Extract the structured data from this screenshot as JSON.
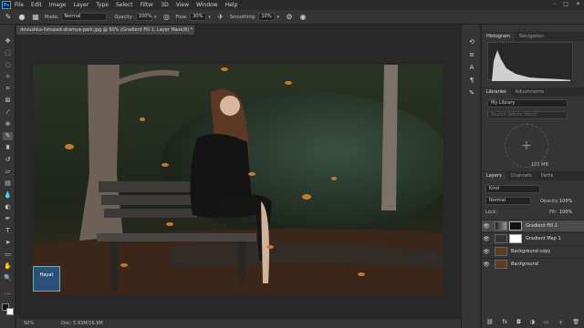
{
  "menu": {
    "logo": "Ps",
    "items": [
      "File",
      "Edit",
      "Image",
      "Layer",
      "Type",
      "Select",
      "Filter",
      "3D",
      "View",
      "Window",
      "Help"
    ],
    "window_controls": [
      "–",
      "□",
      "✕"
    ]
  },
  "options": {
    "mode_label": "Mode:",
    "mode_value": "Normal",
    "opacity_label": "Opacity:",
    "opacity_value": "100%",
    "flow_label": "Flow:",
    "flow_value": "30%",
    "smoothing_label": "Smoothing:",
    "smoothing_value": "10%"
  },
  "document": {
    "tab_title": "devushka-listopad-skamya-park.jpg @ 50% (Gradient Fill 1, Layer Mask/8) *",
    "zoom": "50%",
    "doc_size": "Doc: 5.93M/16.9M",
    "watermark": "Hayat"
  },
  "panels": {
    "top_tabs": [
      "Histogram",
      "Navigation"
    ],
    "library_tabs": [
      "Libraries",
      "Adjustments"
    ],
    "library_select": "My Library",
    "library_search": "Search Adobe Stock",
    "library_size": "101 MB",
    "layers_tabs": [
      "Layers",
      "Channels",
      "Paths"
    ],
    "kind_label": "Kind",
    "blend_mode": "Normal",
    "opacity_label": "Opacity:",
    "opacity_value": "100%",
    "lock_label": "Lock:",
    "fill_label": "Fill:",
    "fill_value": "100%",
    "layers": [
      {
        "name": "Gradient Fill 1",
        "selected": true,
        "italic": false
      },
      {
        "name": "Gradient Map 1",
        "selected": false,
        "italic": false
      },
      {
        "name": "Background copy",
        "selected": false,
        "italic": false
      },
      {
        "name": "Background",
        "selected": false,
        "italic": true
      }
    ]
  }
}
